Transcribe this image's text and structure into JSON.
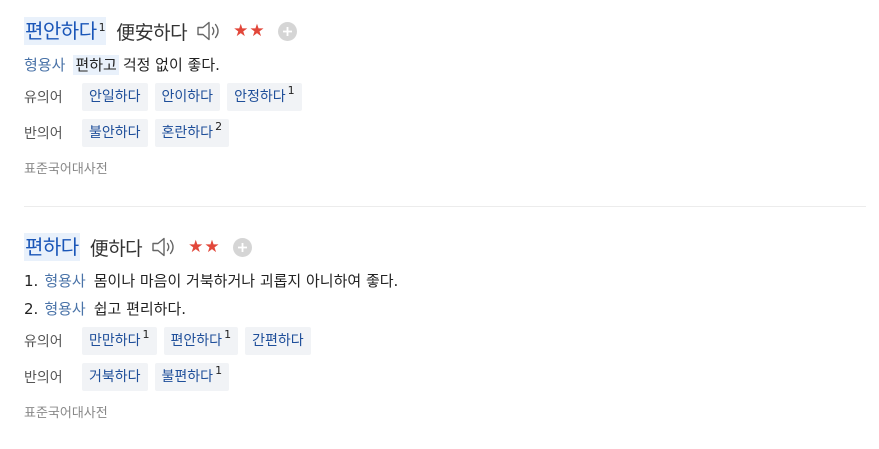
{
  "entries": [
    {
      "headword": "편안하다",
      "superscript": "1",
      "hanja": "便安하다",
      "stars": "★★",
      "definitions": [
        {
          "number": "",
          "pos": "형용사",
          "highlight": "편하고",
          "text": "걱정 없이 좋다."
        }
      ],
      "synonym_label": "유의어",
      "synonyms": [
        {
          "word": "안일하다",
          "sup": ""
        },
        {
          "word": "안이하다",
          "sup": ""
        },
        {
          "word": "안정하다",
          "sup": "1"
        }
      ],
      "antonym_label": "반의어",
      "antonyms": [
        {
          "word": "불안하다",
          "sup": ""
        },
        {
          "word": "혼란하다",
          "sup": "2"
        }
      ],
      "source": "표준국어대사전"
    },
    {
      "headword": "편하다",
      "superscript": "",
      "hanja": "便하다",
      "stars": "★★",
      "definitions": [
        {
          "number": "1.",
          "pos": "형용사",
          "highlight": "",
          "text": "몸이나 마음이 거북하거나 괴롭지 아니하여 좋다."
        },
        {
          "number": "2.",
          "pos": "형용사",
          "highlight": "",
          "text": "쉽고 편리하다."
        }
      ],
      "synonym_label": "유의어",
      "synonyms": [
        {
          "word": "만만하다",
          "sup": "1"
        },
        {
          "word": "편안하다",
          "sup": "1"
        },
        {
          "word": "간편하다",
          "sup": ""
        }
      ],
      "antonym_label": "반의어",
      "antonyms": [
        {
          "word": "거북하다",
          "sup": ""
        },
        {
          "word": "불편하다",
          "sup": "1"
        }
      ],
      "source": "표준국어대사전"
    }
  ],
  "icons": {
    "speaker": "speaker-icon",
    "add": "plus-circle-icon",
    "star": "star-icon"
  },
  "colors": {
    "headword": "#1a56b8",
    "highlight_bg": "#e9f1fb",
    "pos": "#4a73a8",
    "star": "#e2473a",
    "chip_bg": "#f1f3f6"
  }
}
